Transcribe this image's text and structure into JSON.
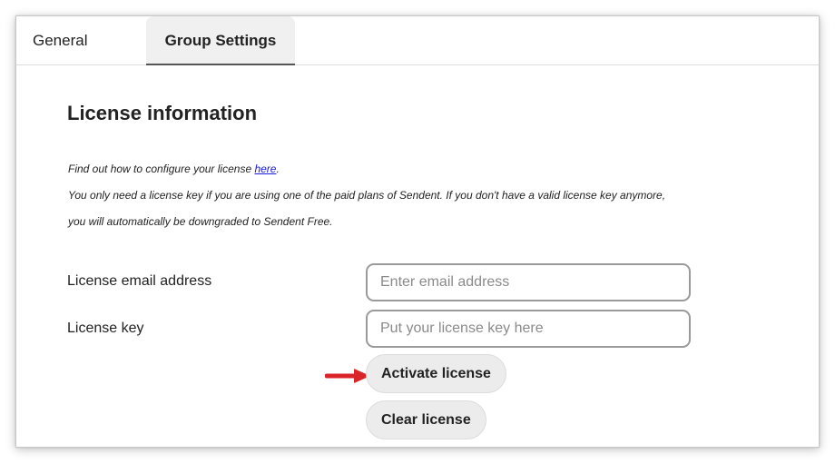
{
  "tabs": {
    "general": "General",
    "group_settings": "Group Settings"
  },
  "section": {
    "title": "License information",
    "info_prefix": "Find out how to configure your license ",
    "info_link": "here",
    "info_suffix": ".",
    "info_line2": "You only need a license key if you are using one of the paid plans of Sendent. If you don't have a valid license key anymore,",
    "info_line3": "you will automatically be downgraded to Sendent Free."
  },
  "form": {
    "email_label": "License email address",
    "email_placeholder": "Enter email address",
    "email_value": "",
    "key_label": "License key",
    "key_placeholder": "Put your license key here",
    "key_value": "",
    "activate_label": "Activate license",
    "clear_label": "Clear license"
  },
  "colors": {
    "arrow": "#d9252a",
    "link": "#1a1ae0",
    "button_bg": "#ececec"
  },
  "icons": {
    "annotation": "red-arrow-icon"
  }
}
